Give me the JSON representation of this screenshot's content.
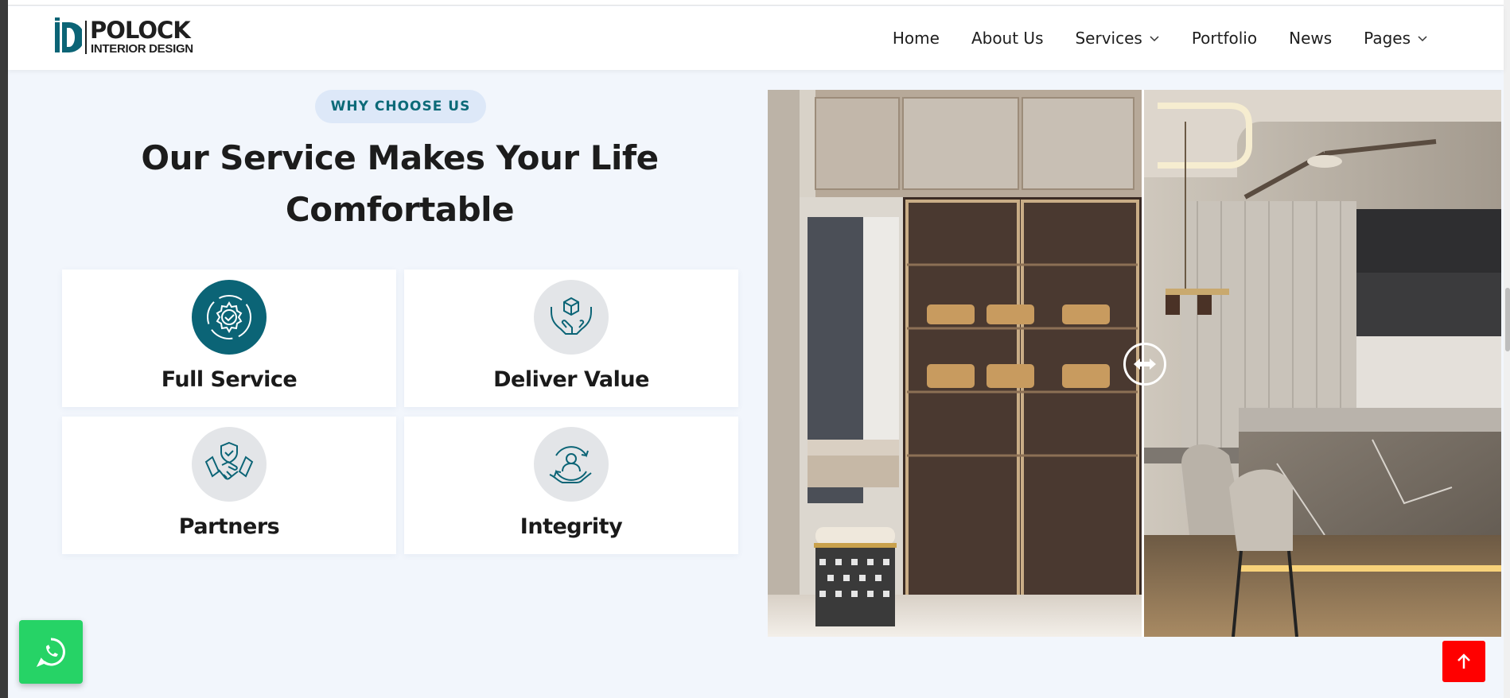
{
  "brand": {
    "name": "POLOCK",
    "tagline": "INTERIOR DESIGN",
    "accent_color": "#0b6476"
  },
  "nav": {
    "items": [
      {
        "label": "Home",
        "dropdown": false
      },
      {
        "label": "About Us",
        "dropdown": false
      },
      {
        "label": "Services",
        "dropdown": true
      },
      {
        "label": "Portfolio",
        "dropdown": false
      },
      {
        "label": "News",
        "dropdown": false
      },
      {
        "label": "Pages",
        "dropdown": true
      }
    ]
  },
  "section": {
    "badge": "WHY CHOOSE US",
    "title_line1": "Our Service Makes Your Life",
    "title_line2": "Comfortable"
  },
  "features": [
    {
      "label": "Full Service",
      "icon": "gear-check-icon",
      "highlighted": true
    },
    {
      "label": "Deliver Value",
      "icon": "hands-box-icon",
      "highlighted": false
    },
    {
      "label": "Partners",
      "icon": "handshake-shield-icon",
      "highlighted": false
    },
    {
      "label": "Integrity",
      "icon": "person-cycle-icon",
      "highlighted": false
    }
  ],
  "compare_slider": {
    "left_scene": "wardrobe-interior",
    "right_scene": "kitchen-dining-interior",
    "handle_icon": "left-right-arrows-icon"
  },
  "floating": {
    "whatsapp_icon": "whatsapp-icon",
    "whatsapp_color": "#26d366",
    "scroll_top_icon": "arrow-up-icon",
    "scroll_top_color": "#ff0000"
  }
}
